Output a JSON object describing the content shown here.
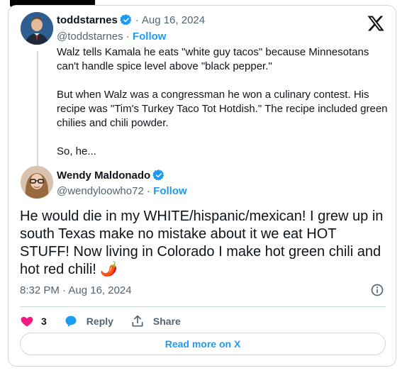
{
  "parent_tweet": {
    "display_name": "toddstarnes",
    "date": "Aug 16, 2024",
    "handle": "@toddstarnes",
    "follow_label": "Follow",
    "paragraphs": [
      "Walz tells Kamala he eats \"white guy tacos\" because Minnesotans can't handle spice level above \"black pepper.\"",
      "But when Walz was a congressman he won a culinary contest. His recipe was \"Tim's Turkey Taco Tot Hotdish.\" The recipe included green chilies and chili powder.",
      "So, he..."
    ]
  },
  "reply_tweet": {
    "display_name": "Wendy Maldonado",
    "handle": "@wendyloowho72",
    "follow_label": "Follow",
    "text": "He would die in my WHITE/hispanic/mexican! I grew up in south Texas make no mistake about it we eat HOT STUFF! Now living in Colorado I make hot green chili and hot red chili! 🌶️",
    "timestamp": "8:32 PM · Aug 16, 2024"
  },
  "actions": {
    "like_count": "3",
    "reply_label": "Reply",
    "share_label": "Share"
  },
  "read_more_label": "Read more on X",
  "separators": {
    "dot": "·"
  },
  "icons": {
    "logo": "x-logo-icon",
    "verified": "verified-badge-icon",
    "info": "info-icon",
    "like": "heart-icon",
    "reply": "speech-bubble-icon",
    "share": "share-upload-icon"
  },
  "colors": {
    "accent": "#1d9bf0",
    "like": "#f91880",
    "text": "#0f1419",
    "muted": "#536471",
    "border": "#cfd9de"
  }
}
